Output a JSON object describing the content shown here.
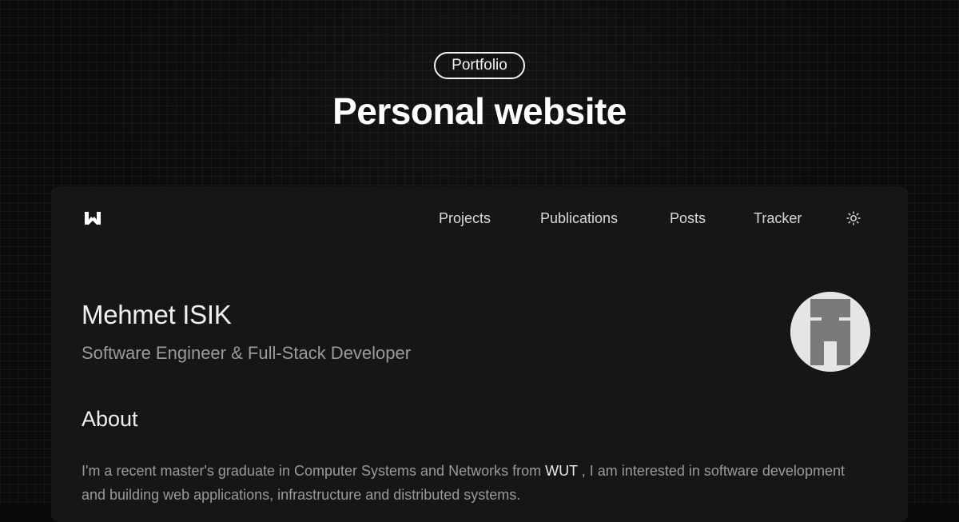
{
  "banner": {
    "tag": "Portfolio",
    "title": "Personal website"
  },
  "site": {
    "logo_icon": "w-logo-icon",
    "nav": {
      "projects": "Projects",
      "publications": "Publications",
      "posts": "Posts",
      "tracker": "Tracker"
    },
    "theme_toggle_icon": "sun-icon"
  },
  "profile": {
    "name": "Mehmet ISIK",
    "role": "Software Engineer & Full-Stack Developer",
    "avatar_icon": "pixel-avatar"
  },
  "about": {
    "heading": "About",
    "text_before": "I'm a recent master's graduate in Computer Systems and Networks from",
    "highlight": "WUT",
    "text_after": ", I am interested in software development and building web applications, infrastructure and distributed systems."
  },
  "colors": {
    "background": "#0b0b0b",
    "card": "#161616",
    "text_primary": "#f0f0f0",
    "text_muted": "#9a9a9a"
  }
}
